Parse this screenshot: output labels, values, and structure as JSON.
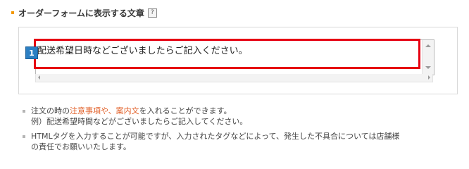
{
  "section": {
    "title": "オーダーフォームに表示する文章",
    "help_label": "?"
  },
  "editor": {
    "badge_number": "1",
    "text_value": "配送希望日時などございましたらご記入ください。"
  },
  "notes": [
    {
      "line1_before": "注文の時の",
      "line1_link1": "注意事項や",
      "line1_sep": "、",
      "line1_link2": "案内文",
      "line1_after": "を入れることができます。",
      "line2": "例）配送希望時間などがございましたらご記入してください。"
    },
    {
      "line1": "HTMLタグを入力することが可能ですが、入力されたタグなどによって、発生した不具合については店舗様",
      "line2": "の責任でお願いいたします。"
    }
  ],
  "colors": {
    "accent_orange": "#f39800",
    "highlight_red": "#e60012",
    "badge_blue": "#2c7fc3",
    "link_orange": "#e2612a"
  }
}
